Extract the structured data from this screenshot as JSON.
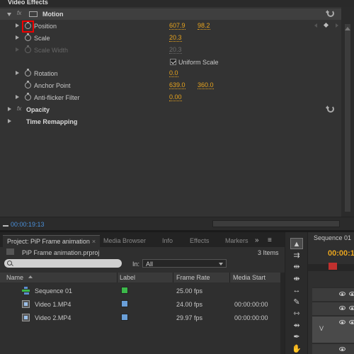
{
  "effect_controls": {
    "header_title": "Video Effects",
    "fx_glyph": "fx",
    "motion": {
      "name": "Motion"
    },
    "properties": [
      {
        "name": "Position",
        "values": [
          "607.9",
          "98.2"
        ],
        "dim": false
      },
      {
        "name": "Scale",
        "values": [
          "20.3"
        ],
        "dim": false
      },
      {
        "name": "Scale Width",
        "values": [
          "20.3"
        ],
        "dim": true
      },
      {
        "name": "Rotation",
        "values": [
          "0.0"
        ],
        "dim": false
      },
      {
        "name": "Anchor Point",
        "values": [
          "639.0",
          "360.0"
        ],
        "dim": false
      },
      {
        "name": "Anti-flicker Filter",
        "values": [
          "0.00"
        ],
        "dim": false
      }
    ],
    "uniform_scale_label": "Uniform Scale",
    "uniform_scale_checked": true,
    "opacity": {
      "name": "Opacity"
    },
    "time_remapping": {
      "name": "Time Remapping"
    },
    "current_time": "00:00:19:13"
  },
  "project": {
    "tabs": [
      {
        "label": "Project: PiP Frame animation",
        "active": true,
        "close": "×"
      },
      {
        "label": "Media Browser",
        "active": false
      },
      {
        "label": "Info",
        "active": false
      },
      {
        "label": "Effects",
        "active": false
      },
      {
        "label": "Markers",
        "active": false
      }
    ],
    "panel_menu_glyph": "»",
    "panel_options_glyph": "≡",
    "file_name": "PiP Frame animation.prproj",
    "item_count": "3 Items",
    "search": {
      "value": "",
      "placeholder": ""
    },
    "in_label": "In:",
    "in_value": "All",
    "columns": [
      "Name",
      "Label",
      "Frame Rate",
      "Media Start"
    ],
    "items": [
      {
        "name": "Sequence 01",
        "type": "sequence",
        "label_color": "#3cb84a",
        "frame_rate": "25.00 fps",
        "media_start": ""
      },
      {
        "name": "Video 1.MP4",
        "type": "video",
        "label_color": "#6a9fd8",
        "frame_rate": "24.00 fps",
        "media_start": "00:00:00:00"
      },
      {
        "name": "Video 2.MP4",
        "type": "video",
        "label_color": "#6a9fd8",
        "frame_rate": "29.97 fps",
        "media_start": "00:00:00:00"
      }
    ]
  },
  "tools": [
    "selection-tool",
    "track-select-tool",
    "ripple-edit-tool",
    "rolling-edit-tool",
    "rate-stretch-tool",
    "razor-tool",
    "slip-tool",
    "slide-tool",
    "pen-tool",
    "hand-tool"
  ],
  "tool_glyphs": [
    "▲",
    "⇉",
    "⇹",
    "⇼",
    "↔",
    "✎",
    "⇿",
    "⇴",
    "✒",
    "✋"
  ],
  "sequence": {
    "tab_label": "Sequence 01",
    "timecode": "00:00:1",
    "track_v_label": "V"
  },
  "colors": {
    "value_orange": "#e8a41e",
    "timecode_blue": "#4a8fd8",
    "highlight_red": "#ee0000"
  }
}
